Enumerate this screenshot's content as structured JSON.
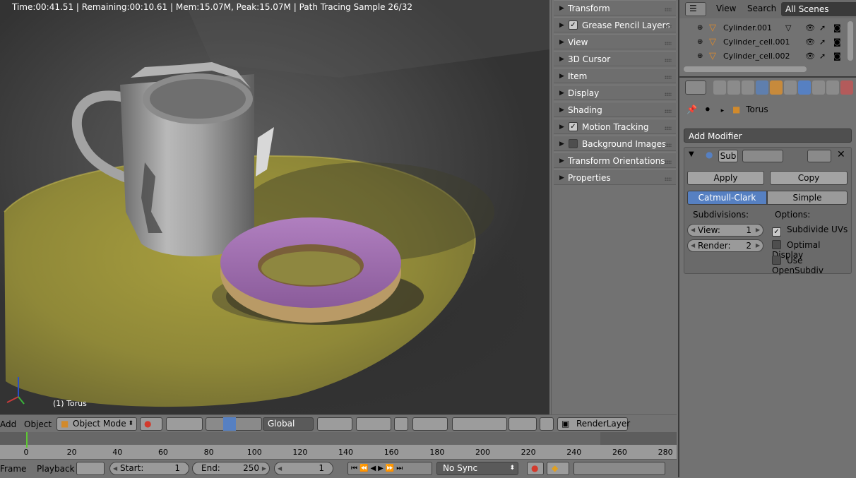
{
  "viewport": {
    "status": "Time:00:41.51 | Remaining:00:10.61 | Mem:15.07M, Peak:15.07M | Path Tracing Sample 26/32",
    "active_object_label": "(1) Torus"
  },
  "npanel": {
    "items": [
      {
        "label": "Transform",
        "checkbox": null
      },
      {
        "label": "Grease Pencil Layers",
        "checkbox": true
      },
      {
        "label": "View",
        "checkbox": null
      },
      {
        "label": "3D Cursor",
        "checkbox": null
      },
      {
        "label": "Item",
        "checkbox": null
      },
      {
        "label": "Display",
        "checkbox": null
      },
      {
        "label": "Shading",
        "checkbox": null
      },
      {
        "label": "Motion Tracking",
        "checkbox": true
      },
      {
        "label": "Background Images",
        "checkbox": false
      },
      {
        "label": "Transform Orientations",
        "checkbox": null
      },
      {
        "label": "Properties",
        "checkbox": null
      }
    ]
  },
  "outliner": {
    "menu_view": "View",
    "menu_search": "Search",
    "scenes_select": "All Scenes",
    "rows": [
      {
        "name": "Cylinder.001"
      },
      {
        "name": "Cylinder_cell.001"
      },
      {
        "name": "Cylinder_cell.002"
      }
    ]
  },
  "properties": {
    "breadcrumb_object": "Torus",
    "add_modifier": "Add Modifier",
    "modifier": {
      "name": "Sub",
      "apply": "Apply",
      "copy": "Copy",
      "type_catmull": "Catmull-Clark",
      "type_simple": "Simple",
      "subdivisions_label": "Subdivisions:",
      "options_label": "Options:",
      "view_label": "View:",
      "view_value": "1",
      "render_label": "Render:",
      "render_value": "2",
      "subdivide_uvs": "Subdivide UVs",
      "optimal_display": "Optimal Display",
      "use_opensubdiv": "Use OpenSubdiv"
    }
  },
  "view3d_header": {
    "menu_add": "Add",
    "menu_object": "Object",
    "mode": "Object Mode",
    "orientation": "Global",
    "render_layer": "RenderLayer"
  },
  "timeline": {
    "ticks": [
      "0",
      "20",
      "40",
      "60",
      "80",
      "100",
      "120",
      "140",
      "160",
      "180",
      "200",
      "220",
      "240",
      "260",
      "280"
    ],
    "menu_frame": "Frame",
    "menu_playback": "Playback",
    "start_label": "Start:",
    "start_value": "1",
    "end_label": "End:",
    "end_value": "250",
    "current_frame": "1",
    "sync": "No Sync"
  },
  "colors": {
    "accent_blue": "#5680c2",
    "keyframe_green": "#5ec833",
    "record_red": "#d33a2c"
  }
}
